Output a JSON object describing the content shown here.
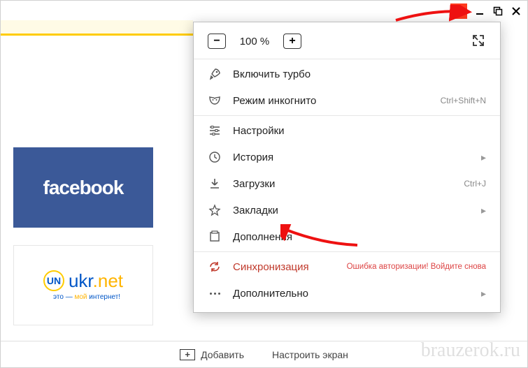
{
  "titlebar": {
    "menu_icon": "hamburger",
    "minimize_icon": "minimize",
    "maximize_icon": "maximize",
    "close_icon": "close"
  },
  "zoom": {
    "minus": "−",
    "value": "100 %",
    "plus": "+",
    "fullscreen_icon": "expand"
  },
  "menu": {
    "turbo": "Включить турбо",
    "incognito": "Режим инкогнито",
    "incognito_shortcut": "Ctrl+Shift+N",
    "settings": "Настройки",
    "history": "История",
    "downloads": "Загрузки",
    "downloads_shortcut": "Ctrl+J",
    "bookmarks": "Закладки",
    "extensions": "Дополнения",
    "sync": "Синхронизация",
    "sync_error": "Ошибка авторизации! Войдите снова",
    "more": "Дополнительно"
  },
  "tiles": {
    "facebook": "facebook",
    "ukr_main": "ukr",
    "ukr_net": ".net",
    "ukr_badge": "UN",
    "ukr_sub_pre": "это — ",
    "ukr_sub_hi": "мой",
    "ukr_sub_post": " интернет!"
  },
  "bottom": {
    "add": "Добавить",
    "customize": "Настроить экран"
  },
  "watermark": "brauzerok.ru"
}
